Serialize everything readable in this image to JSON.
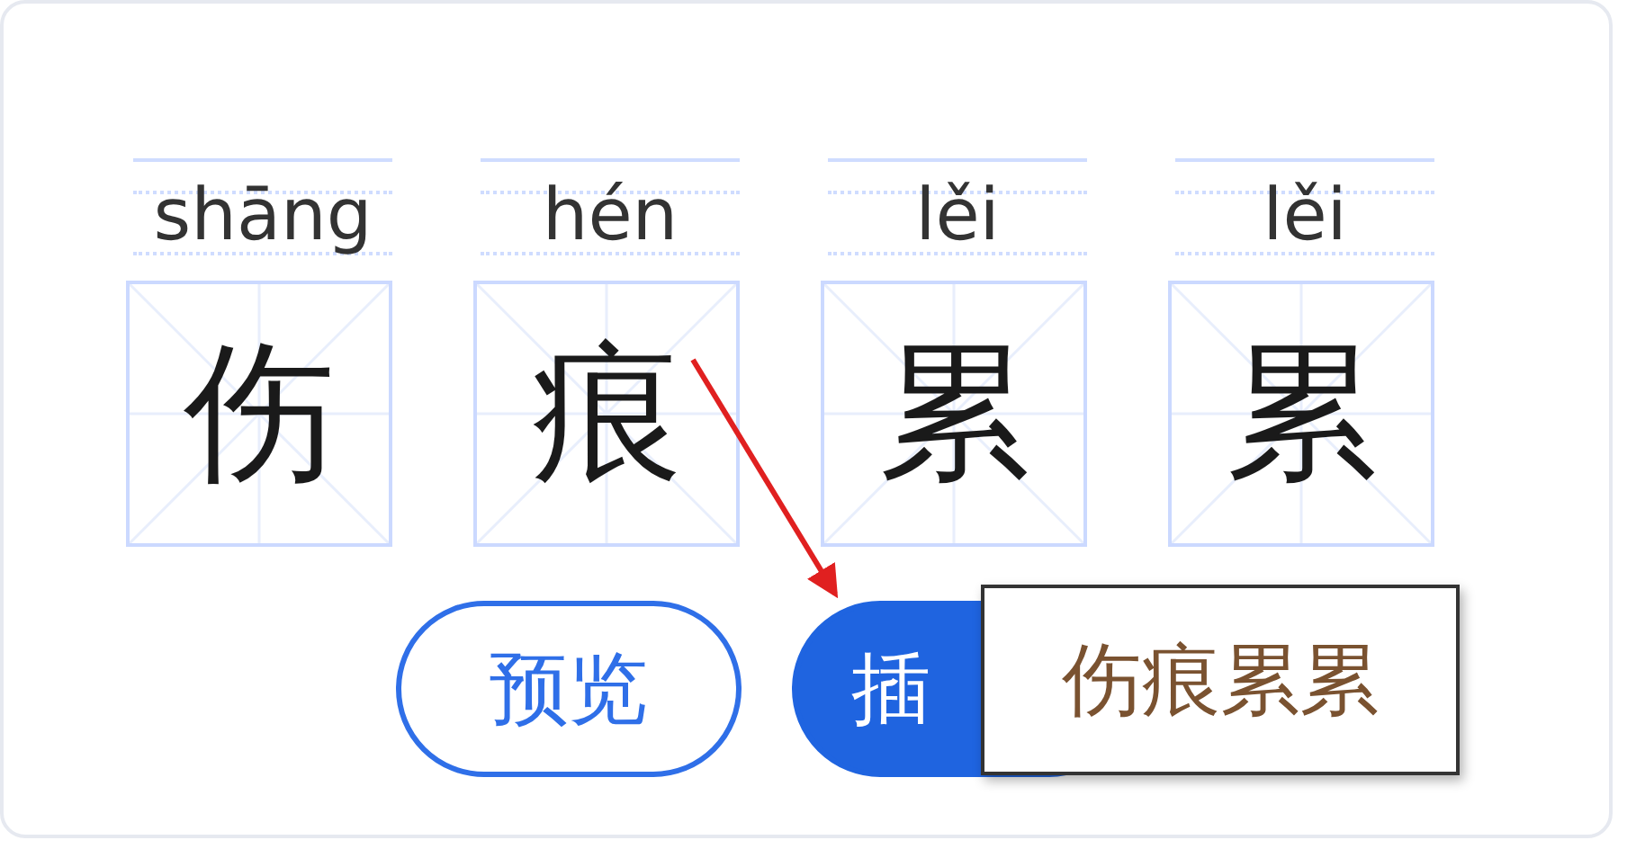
{
  "characters": [
    {
      "pinyin": "shāng",
      "hanzi": "伤"
    },
    {
      "pinyin": "hén",
      "hanzi": "痕"
    },
    {
      "pinyin": "lěi",
      "hanzi": "累"
    },
    {
      "pinyin": "lěi",
      "hanzi": "累"
    }
  ],
  "buttons": [
    {
      "label": "预览",
      "kind": "outline"
    },
    {
      "label": "插",
      "kind": "filled"
    }
  ],
  "tooltip": {
    "text": "伤痕累累"
  }
}
